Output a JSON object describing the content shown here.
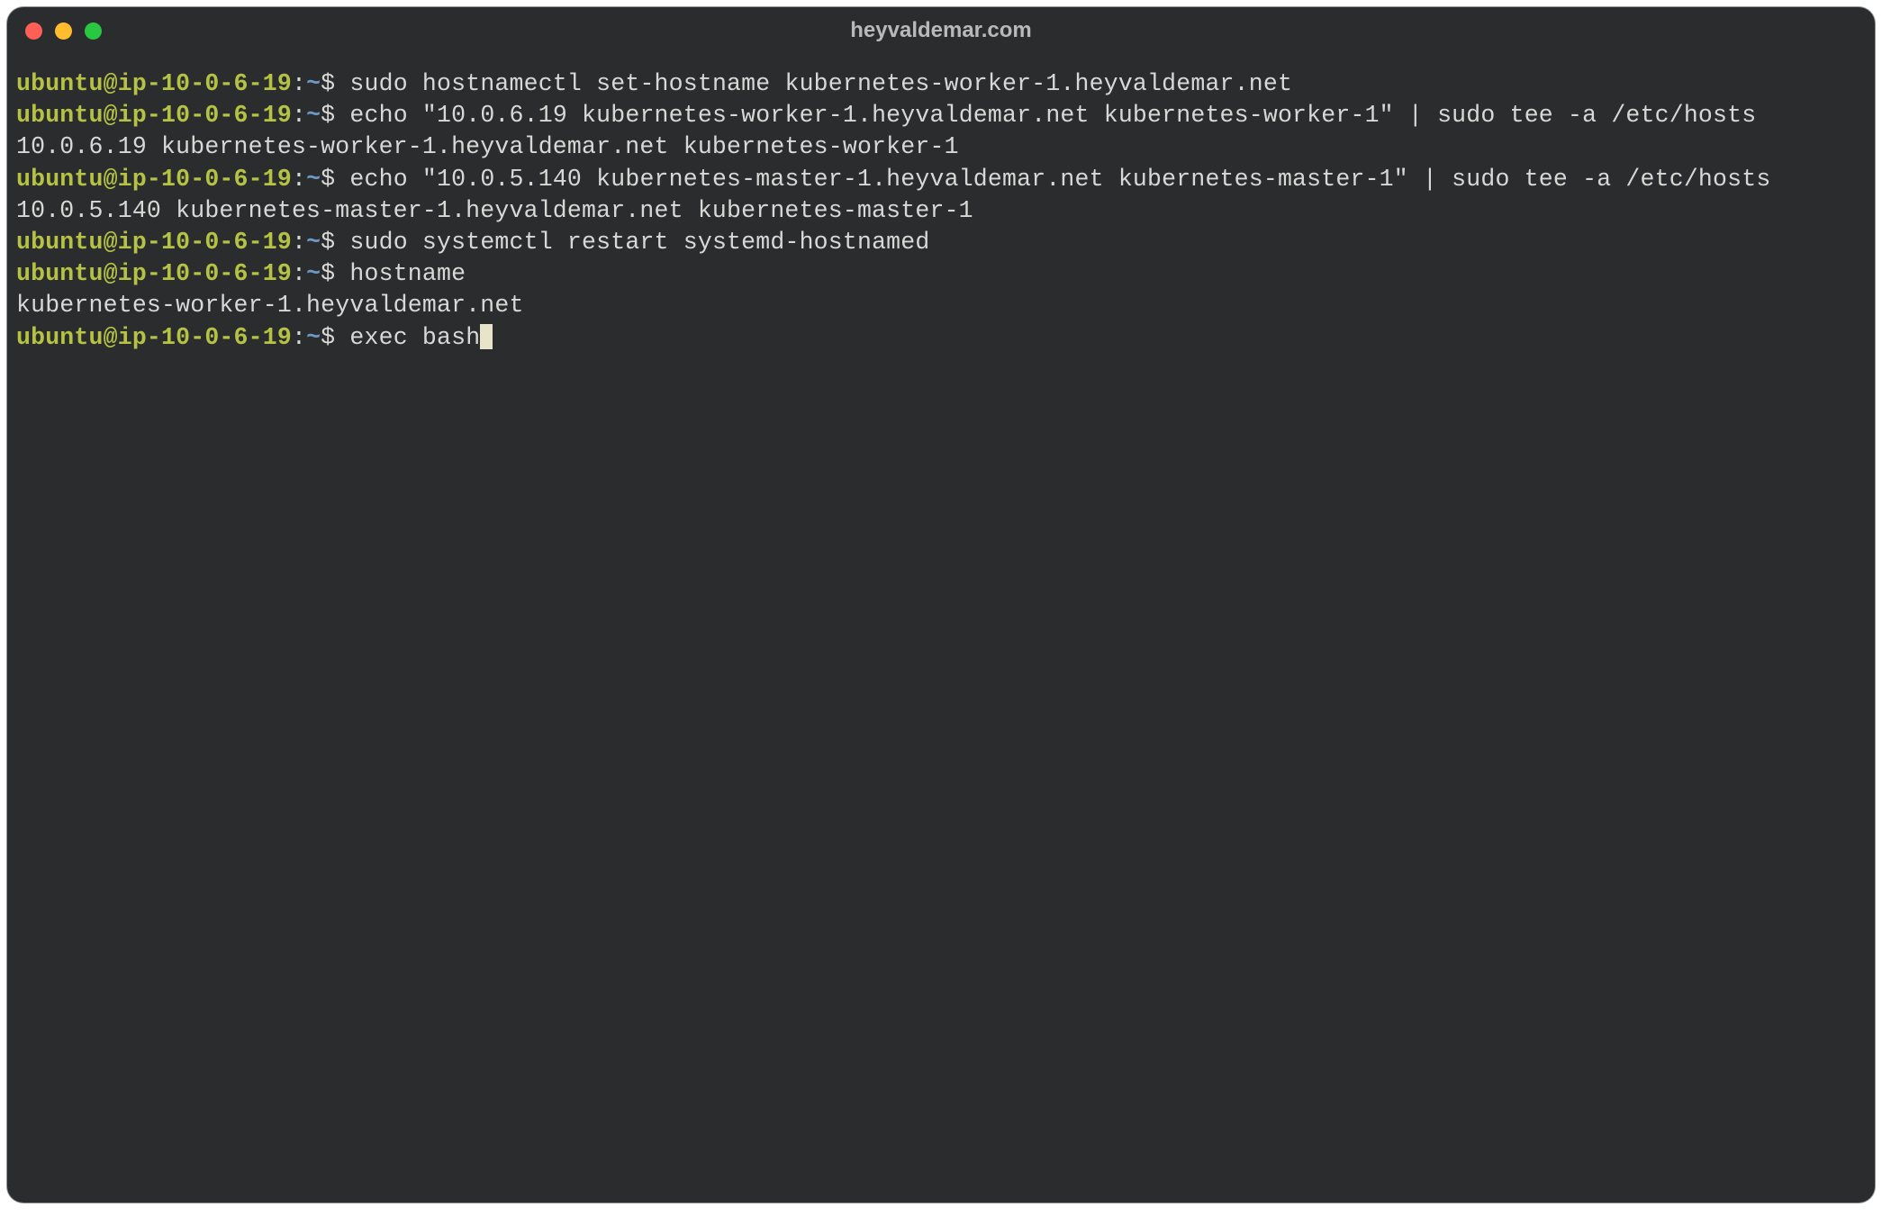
{
  "window": {
    "title": "heyvaldemar.com"
  },
  "prompt": {
    "user_host": "ubuntu@ip-10-0-6-19",
    "sep": ":",
    "path": "~",
    "sigil": "$"
  },
  "lines": [
    {
      "type": "cmd",
      "text": "sudo hostnamectl set-hostname kubernetes-worker-1.heyvaldemar.net"
    },
    {
      "type": "cmd",
      "text": "echo \"10.0.6.19 kubernetes-worker-1.heyvaldemar.net kubernetes-worker-1\" | sudo tee -a /etc/hosts"
    },
    {
      "type": "out",
      "text": "10.0.6.19 kubernetes-worker-1.heyvaldemar.net kubernetes-worker-1"
    },
    {
      "type": "cmd",
      "text": "echo \"10.0.5.140 kubernetes-master-1.heyvaldemar.net kubernetes-master-1\" | sudo tee -a /etc/hosts"
    },
    {
      "type": "out",
      "text": "10.0.5.140 kubernetes-master-1.heyvaldemar.net kubernetes-master-1"
    },
    {
      "type": "cmd",
      "text": "sudo systemctl restart systemd-hostnamed"
    },
    {
      "type": "cmd",
      "text": "hostname"
    },
    {
      "type": "out",
      "text": "kubernetes-worker-1.heyvaldemar.net"
    },
    {
      "type": "cmd",
      "text": "exec bash",
      "cursor": true
    }
  ]
}
